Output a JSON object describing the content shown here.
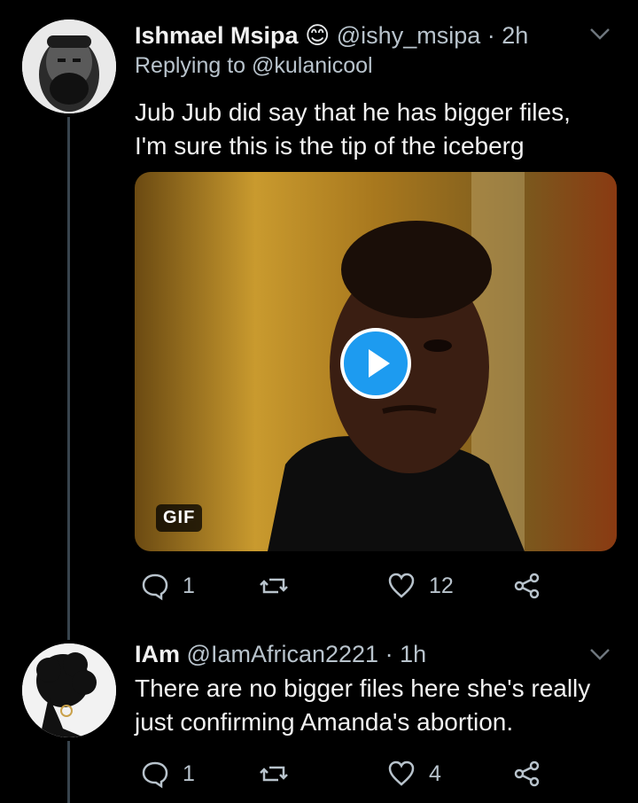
{
  "tweets": [
    {
      "name": "Ishmael Msipa",
      "emoji": "😊",
      "handle": "@ishy_msipa",
      "separator": "·",
      "time": "2h",
      "replying_to": "Replying to @kulanicool",
      "text_line1": "Jub Jub did say that he has bigger files,",
      "text_line2": "I'm sure this is the tip of the iceberg",
      "media_badge": "GIF",
      "reply_count": "1",
      "retweet_count": "",
      "like_count": "12"
    },
    {
      "name": "IAm",
      "handle": "@IamAfrican2221",
      "separator": "·",
      "time": "1h",
      "text_line1": "There are no bigger files here she's really",
      "text_line2": "just confirming Amanda's abortion.",
      "reply_count": "1",
      "retweet_count": "",
      "like_count": "4"
    }
  ],
  "icons": {
    "reply": "reply-icon",
    "retweet": "retweet-icon",
    "like": "heart-icon",
    "share": "share-icon",
    "menu": "chevron-down-icon",
    "play": "play-icon"
  },
  "colors": {
    "background": "#000000",
    "muted": "#b8c3cc",
    "accent": "#1d9bf0"
  }
}
